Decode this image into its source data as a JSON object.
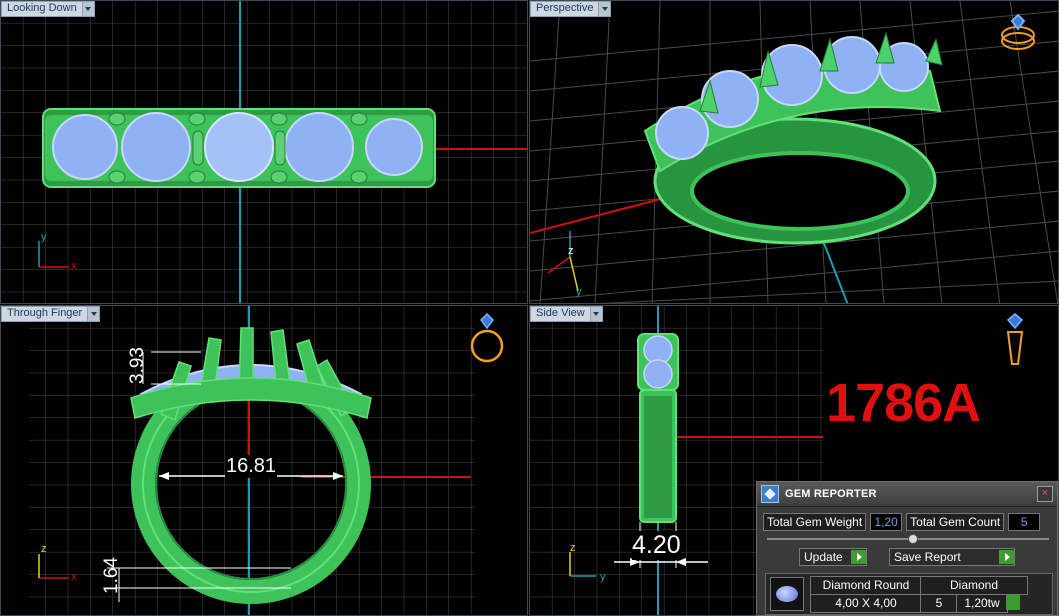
{
  "viewports": {
    "top_left": {
      "label": "Looking Down",
      "axis_x": "x",
      "axis_y": "y"
    },
    "top_right": {
      "label": "Perspective",
      "axis_z": "z",
      "axis_y": "y"
    },
    "bottom_left": {
      "label": "Through Finger",
      "axis_z": "z",
      "axis_x": "x",
      "dim_height": "3.93",
      "dim_diameter": "16.81",
      "dim_thickness": "1.64"
    },
    "bottom_right": {
      "label": "Side View",
      "axis_z": "z",
      "axis_y": "y",
      "dim_width": "4.20"
    }
  },
  "model_code": "1786A",
  "gem_reporter": {
    "title": "GEM REPORTER",
    "close": "×",
    "total_weight_label": "Total Gem Weight",
    "total_weight_value": "1,20",
    "total_count_label": "Total Gem Count",
    "total_count_value": "5",
    "update_label": "Update",
    "save_label": "Save Report",
    "row": {
      "shape": "Diamond Round",
      "size": "4,00 X 4,00",
      "material": "Diamond",
      "count": "5",
      "weight": "1,20tw"
    }
  },
  "colors": {
    "metal": "#3ec25a",
    "gem": "#8fb2f5",
    "grid": "#4d4d4d",
    "axis_red": "#d01010",
    "axis_teal": "#1aa0b0",
    "code_red": "#e01010"
  }
}
